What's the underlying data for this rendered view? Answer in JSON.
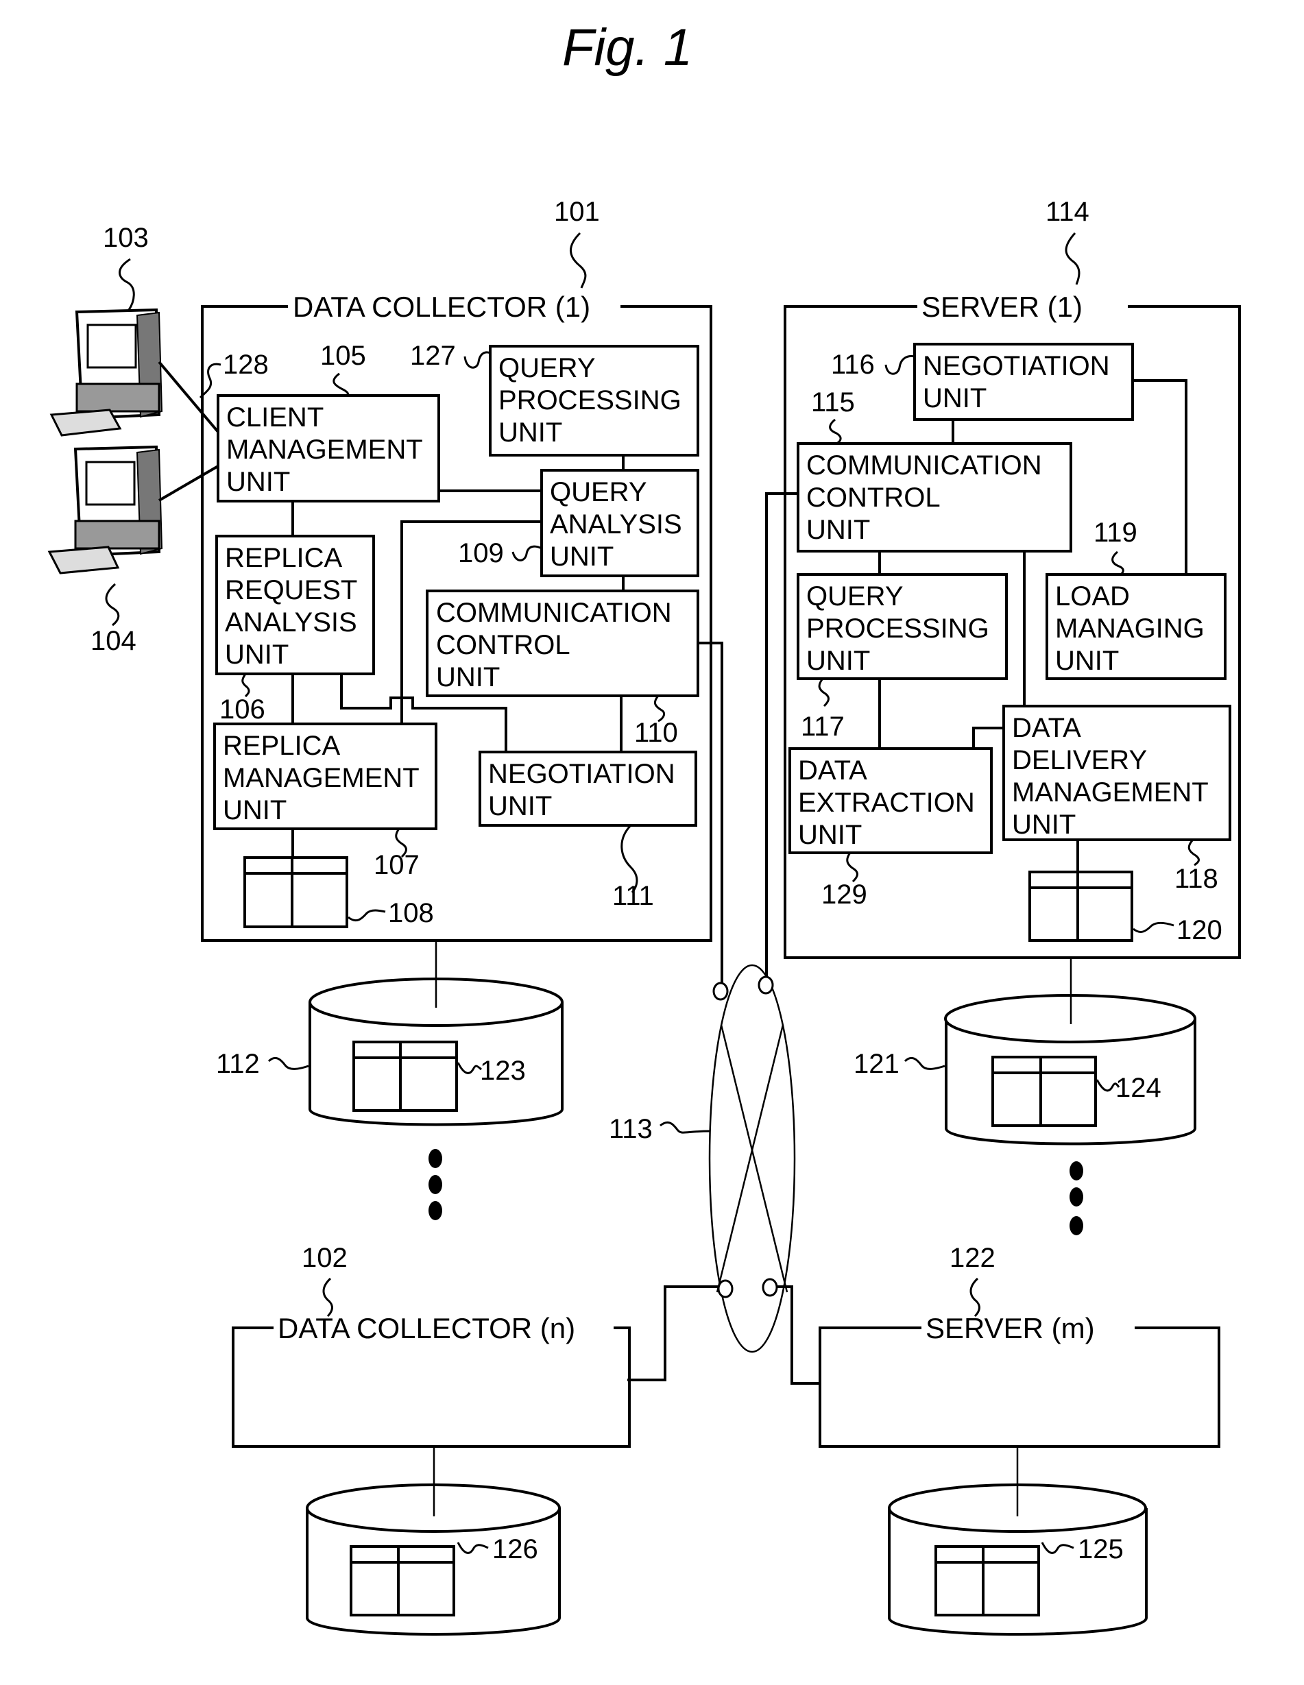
{
  "figure": {
    "title": "Fig. 1"
  },
  "data_collector_1": {
    "label": "DATA COLLECTOR (1)",
    "ref": "101",
    "units": {
      "client_management": {
        "lines": [
          "CLIENT",
          "MANAGEMENT",
          "UNIT"
        ],
        "ref": "105"
      },
      "query_processing": {
        "lines": [
          "QUERY",
          "PROCESSING",
          "UNIT"
        ],
        "ref": "127"
      },
      "query_analysis": {
        "lines": [
          "QUERY",
          "ANALYSIS",
          "UNIT"
        ],
        "ref": "109"
      },
      "replica_request_analysis": {
        "lines": [
          "REPLICA",
          "REQUEST",
          "ANALYSIS",
          "UNIT"
        ],
        "ref": "106"
      },
      "communication_control": {
        "lines": [
          "COMMUNICATION",
          "CONTROL",
          "UNIT"
        ],
        "ref": "110"
      },
      "replica_management": {
        "lines": [
          "REPLICA",
          "MANAGEMENT",
          "UNIT"
        ],
        "ref": "107"
      },
      "negotiation": {
        "lines": [
          "NEGOTIATION",
          "UNIT"
        ],
        "ref": "111"
      }
    },
    "table_ref": "108",
    "client_link_ref": "128"
  },
  "clients": [
    {
      "name": "client-terminal",
      "ref": "103"
    },
    {
      "name": "client-terminal",
      "ref": "104"
    }
  ],
  "server_1": {
    "label": "SERVER (1)",
    "ref": "114",
    "units": {
      "negotiation": {
        "lines": [
          "NEGOTIATION",
          "UNIT"
        ],
        "ref": "116"
      },
      "communication_control": {
        "lines": [
          "COMMUNICATION",
          "CONTROL",
          "UNIT"
        ],
        "ref": "115"
      },
      "query_processing": {
        "lines": [
          "QUERY",
          "PROCESSING",
          "UNIT"
        ],
        "ref": "117"
      },
      "load_managing": {
        "lines": [
          "LOAD",
          "MANAGING",
          "UNIT"
        ],
        "ref": "119"
      },
      "data_extraction": {
        "lines": [
          "DATA",
          "EXTRACTION",
          "UNIT"
        ],
        "ref": "129"
      },
      "data_delivery_management": {
        "lines": [
          "DATA",
          "DELIVERY",
          "MANAGEMENT",
          "UNIT"
        ],
        "ref": "118"
      }
    },
    "table_ref": "120"
  },
  "network": {
    "ref": "113"
  },
  "databases": {
    "collector_1": {
      "ref": "112",
      "table_ref": "123"
    },
    "server_1": {
      "ref": "121",
      "table_ref": "124"
    },
    "collector_n": {
      "table_ref": "126"
    },
    "server_m": {
      "table_ref": "125"
    }
  },
  "data_collector_n": {
    "label": "DATA COLLECTOR (n)",
    "ref": "102"
  },
  "server_m": {
    "label": "SERVER (m)",
    "ref": "122"
  }
}
